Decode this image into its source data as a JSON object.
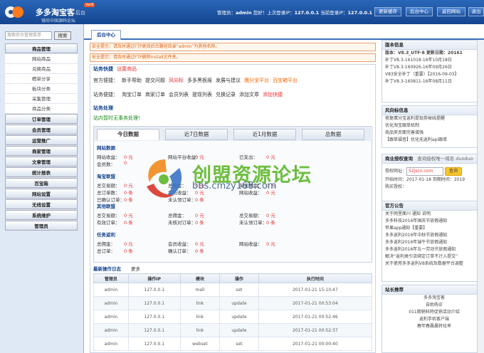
{
  "header": {
    "title": "多多淘宝客",
    "title_sub": "后台",
    "badge": "Ver8",
    "tagline": "镜尚中国源码论坛",
    "admin_label": "管理员：",
    "admin_name": "admin",
    "greeting": " 您好！上次登录IP：",
    "last_ip": "127.0.0.1",
    "current_ip_label": " 当前登录IP：",
    "current_ip": "127.0.0.1",
    "buttons": [
      "更新缓存",
      "后台中心",
      "返回网站",
      "退出"
    ]
  },
  "sidebar": {
    "search_placeholder": "搜索后台管理菜单",
    "search_button": "搜索",
    "sections": [
      {
        "label": "商品管理",
        "items": [
          "网站商品",
          "兑换商品",
          "晒单分享",
          "板块分类",
          "采集管理",
          "商品分类"
        ]
      },
      {
        "label": "订单管理",
        "items": []
      },
      {
        "label": "会员管理",
        "items": []
      },
      {
        "label": "运营推广",
        "items": []
      },
      {
        "label": "商家管理",
        "items": []
      },
      {
        "label": "文章管理",
        "items": []
      },
      {
        "label": "统计报表",
        "items": []
      },
      {
        "label": "百宝箱",
        "items": []
      },
      {
        "label": "网站设置",
        "items": []
      },
      {
        "label": "无线设置",
        "items": []
      },
      {
        "label": "系统维护",
        "items": []
      },
      {
        "label": "管理员",
        "items": []
      }
    ]
  },
  "tabs": {
    "home": "后台中心"
  },
  "notices": [
    "安全提示：请及时通过FTP更改后台路径目录“admin”为其他名称。",
    "安全提示：请及时通过FTP删除install文件夹。"
  ],
  "shortcuts": {
    "title": "站务快捷",
    "settings_link": "设置商品",
    "row1": [
      {
        "t": "官方便捷：",
        "c": ""
      },
      {
        "t": "新手帮助",
        "c": ""
      },
      {
        "t": "提交问题",
        "c": ""
      },
      {
        "t": "风向标",
        "c": "red"
      },
      {
        "t": "多多黑板报",
        "c": ""
      },
      {
        "t": "发展与建议",
        "c": ""
      },
      {
        "t": "鹰分宝平台",
        "c": "orange"
      },
      {
        "t": "百宝箱平台",
        "c": "orange"
      }
    ],
    "row2": [
      {
        "t": "站务便捷：",
        "c": ""
      },
      {
        "t": "淘宝订单",
        "c": ""
      },
      {
        "t": "商家订单",
        "c": ""
      },
      {
        "t": "会员列表",
        "c": ""
      },
      {
        "t": "提现列表",
        "c": ""
      },
      {
        "t": "兑换记录",
        "c": ""
      },
      {
        "t": "添加文章",
        "c": ""
      },
      {
        "t": "添加快捷",
        "c": "red"
      }
    ]
  },
  "todo": {
    "title": "站务处理",
    "text": "站内暂时无事务处理！"
  },
  "stats": {
    "tabs": [
      "今日数据",
      "近7日数据",
      "近1月数据",
      "总数据"
    ],
    "site_title": "网站数据",
    "site_rows": [
      {
        "a": "网站收益：",
        "av": "0 元",
        "b": "网站平台收益：",
        "bv": "0 元",
        "c": "已支出：",
        "cv": "0 元"
      },
      {
        "a": "会员数：",
        "av": "0",
        "b": "",
        "bv": "",
        "c": "",
        "cv": ""
      }
    ],
    "taobao_title": "淘宝联盟",
    "taobao_rows": [
      {
        "a": "总交易额：",
        "av": "0 元",
        "b": "总佣金：",
        "bv": "0 元",
        "c": "淘宝佣金：",
        "cv": "0 元"
      },
      {
        "a": "总订单数：",
        "av": "0 条",
        "b": "会员收益：",
        "bv": "0 元",
        "c": "网站收益：",
        "cv": "0 元"
      },
      {
        "a": "已确认订单：",
        "av": "0 条",
        "b": "未认领订单：",
        "bv": "0 条",
        "c": "",
        "cv": ""
      }
    ],
    "other_title": "其他联盟",
    "other_rows": [
      {
        "a": "总交易额：",
        "av": "0 元",
        "b": "总佣金：",
        "bv": "0 元",
        "c": "总交易额：",
        "cv": "0 元"
      },
      {
        "a": "有效订单：",
        "av": "0 条",
        "b": "未核对订单：",
        "bv": "0 条",
        "c": "未认领订单：",
        "cv": "0 条"
      }
    ],
    "task_title": "任务返利",
    "task_rows": [
      {
        "a": "总佣金：",
        "av": "0 元",
        "b": "会员收益：",
        "bv": "0 元",
        "c": "网站收益：",
        "cv": "0 元"
      },
      {
        "a": "总订单：",
        "av": "0 条",
        "b": "确认订单：",
        "bv": "0 条",
        "c": "",
        "cv": ""
      }
    ]
  },
  "log": {
    "title": "最新操作日志",
    "more": "更多",
    "headers": [
      "管理员",
      "操作IP",
      "模块",
      "操作",
      "执行时间"
    ],
    "rows": [
      [
        "admin",
        "127.0.0.1",
        "mall",
        "set",
        "2017-01-21 15:10:47"
      ],
      [
        "admin",
        "127.0.0.1",
        "link",
        "update",
        "2017-01-21 00:53:04"
      ],
      [
        "admin",
        "127.0.0.1",
        "link",
        "update",
        "2017-01-21 00:52:46"
      ],
      [
        "admin",
        "127.0.0.1",
        "link",
        "update",
        "2017-01-21 00:52:37"
      ],
      [
        "admin",
        "127.0.0.1",
        "webset",
        "set",
        "2017-01-21 00:00:40"
      ]
    ]
  },
  "right": {
    "version": {
      "title": "版本信息",
      "main": "版本：V8.3_UTF-8 更新日期：20161",
      "items": [
        "补丁V8.3-161018-16年10月18日",
        "补丁V8.3-160926-16年09月26日",
        "V83安全补丁（重要）【2016-09-03】",
        "补丁V8.3-160811-16年08月11日"
      ]
    },
    "wind": {
      "title": "风向标信息",
      "items": [
        "修复鹰分宝返利提现券掉线提醒",
        "优化淘宝跟单机制",
        "商品夹页面完善增强",
        "【跟单福音】优化无返利api跟单"
      ]
    },
    "license": {
      "title": "商业授权查询",
      "query": "查询授权唯一域名 duoduo",
      "domain_label": "授权网址：",
      "domain": "52jscn.com",
      "query_btn": "查询",
      "start_label": "开始时间：",
      "start": "2017-01-18",
      "end_label": "到期时间：",
      "end": "2019",
      "buy": "购买授权："
    },
    "official": {
      "title": "官方公告",
      "items": [
        "关于网里面川 通知 说明",
        "多多科技2016年国庆节放假通知",
        "苹果app通知【重要】",
        "多多返利2016年中秋节放假通知",
        "多多返利2016年端午节放假通知",
        "多多返利2016年五一劳动节放假通知",
        "解决“返利类引流绑定订单不计入提交”",
        "关于使用多多返利V8系统及数据平台调整"
      ]
    },
    "recommend": {
      "title": "站长推荐",
      "items": [
        "多多淘宝客",
        "自助购买",
        "011期销科特促销活动介绍",
        "返利手机客户端",
        "春年春晨晨转化率"
      ]
    }
  },
  "watermark": {
    "text": "创盟资源论坛",
    "url": "bbs.cmzy168.com"
  }
}
